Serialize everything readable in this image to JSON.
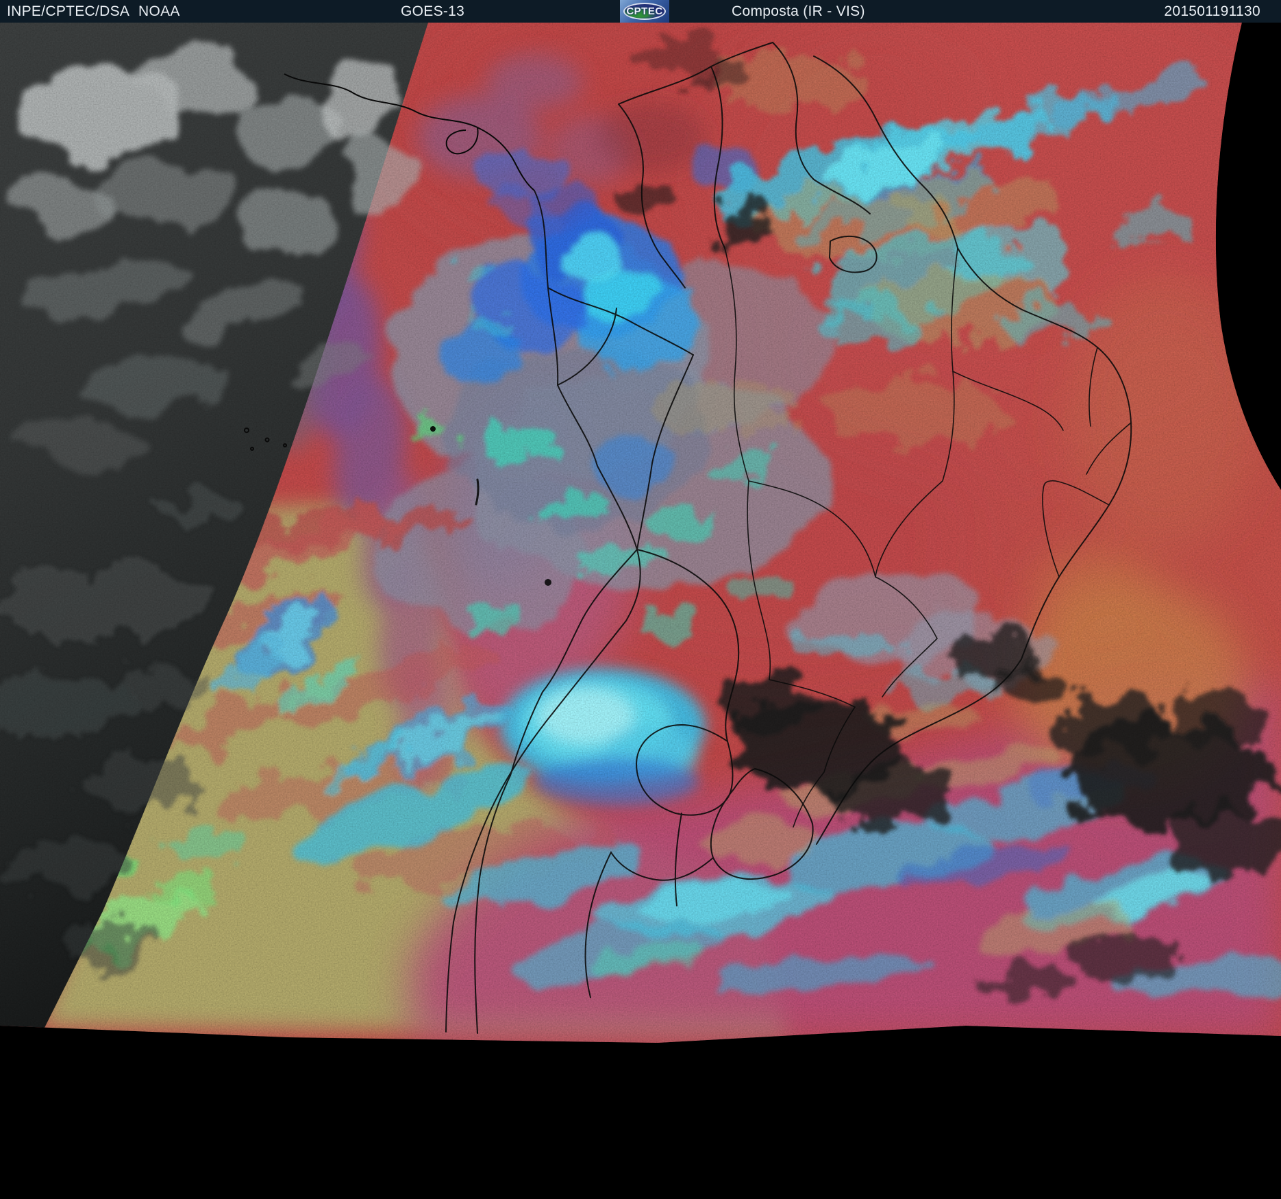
{
  "header": {
    "agency": "INPE/CPTEC/DSA",
    "organization": "NOAA",
    "satellite": "GOES-13",
    "logo": {
      "text": "CPTEC"
    },
    "product": "Composta (IR - VIS)",
    "timestamp": "201501191130"
  },
  "colors": {
    "header-bg": "#0d1b26",
    "header-text": "#e9eef3",
    "map-bg": "#000000",
    "ir-red": "#c24a4a",
    "vis-gray": "#333737",
    "khaki": "#b1ad6d",
    "magenta": "#b94f7c",
    "orange": "#c97c4a",
    "cloud-cyan": "#4fd0e8",
    "cloud-blue": "#2f7de8",
    "border-line": "#0b0b0b"
  }
}
